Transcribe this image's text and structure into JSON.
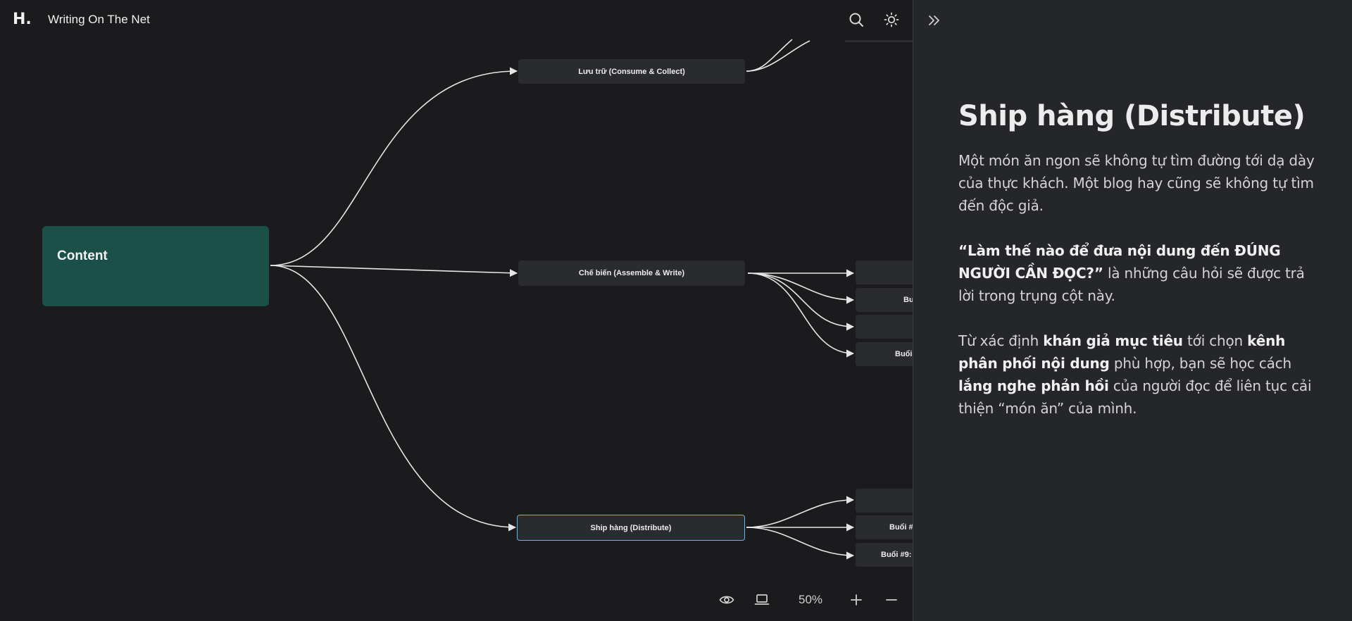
{
  "header": {
    "logo_text": "H.",
    "site_title": "Writing On The Net",
    "icons": [
      "search-icon",
      "sun-icon"
    ]
  },
  "mindmap": {
    "root": {
      "label": "Content",
      "color": "#1a5048"
    },
    "branches": [
      {
        "label": "Lưu trữ (Consume & Collect)"
      },
      {
        "label": "Chế biến (Assemble & Write)"
      },
      {
        "label": "Ship hàng (Distribute)",
        "selected": true,
        "selected_color": "#5ab7e8"
      }
    ],
    "assemble_children": [
      "",
      "Bu",
      "",
      "Buổi"
    ],
    "distribute_children": [
      "",
      "Buổi #",
      "Buổi #9:"
    ]
  },
  "toolbar": {
    "icons": [
      "eye-icon",
      "laptop-icon",
      "plus-icon",
      "minus-icon"
    ],
    "zoom": "50%"
  },
  "panel": {
    "collapse_icon": "double-chevron-right-icon",
    "title": "Ship hàng (Distribute)",
    "p1": "Một món ăn ngon sẽ không tự tìm đường tới dạ dày của thực khách. Một blog hay cũng sẽ không tự tìm đến độc giả.",
    "p2_bold": "“Làm thế nào để đưa nội dung đến ĐÚNG NGƯỜI CẦN ĐỌC?”",
    "p2_rest": " là những câu hỏi sẽ được trả lời trong trụng cột này.",
    "p3_a": "Từ xác định ",
    "p3_b1": "khán giả mục tiêu",
    "p3_c": " tới chọn ",
    "p3_b2": "kênh phân phối nội dung",
    "p3_d": " phù hợp, bạn sẽ học cách ",
    "p3_b3": "lắng nghe phản hồi",
    "p3_e": " của người đọc để liên tục cải thiện “món ăn” của mình."
  },
  "colors": {
    "canvas_bg": "#1b1b1d",
    "panel_bg": "#25262a",
    "node_bg": "#2a2b2e",
    "accent": "#5ab7e8"
  }
}
